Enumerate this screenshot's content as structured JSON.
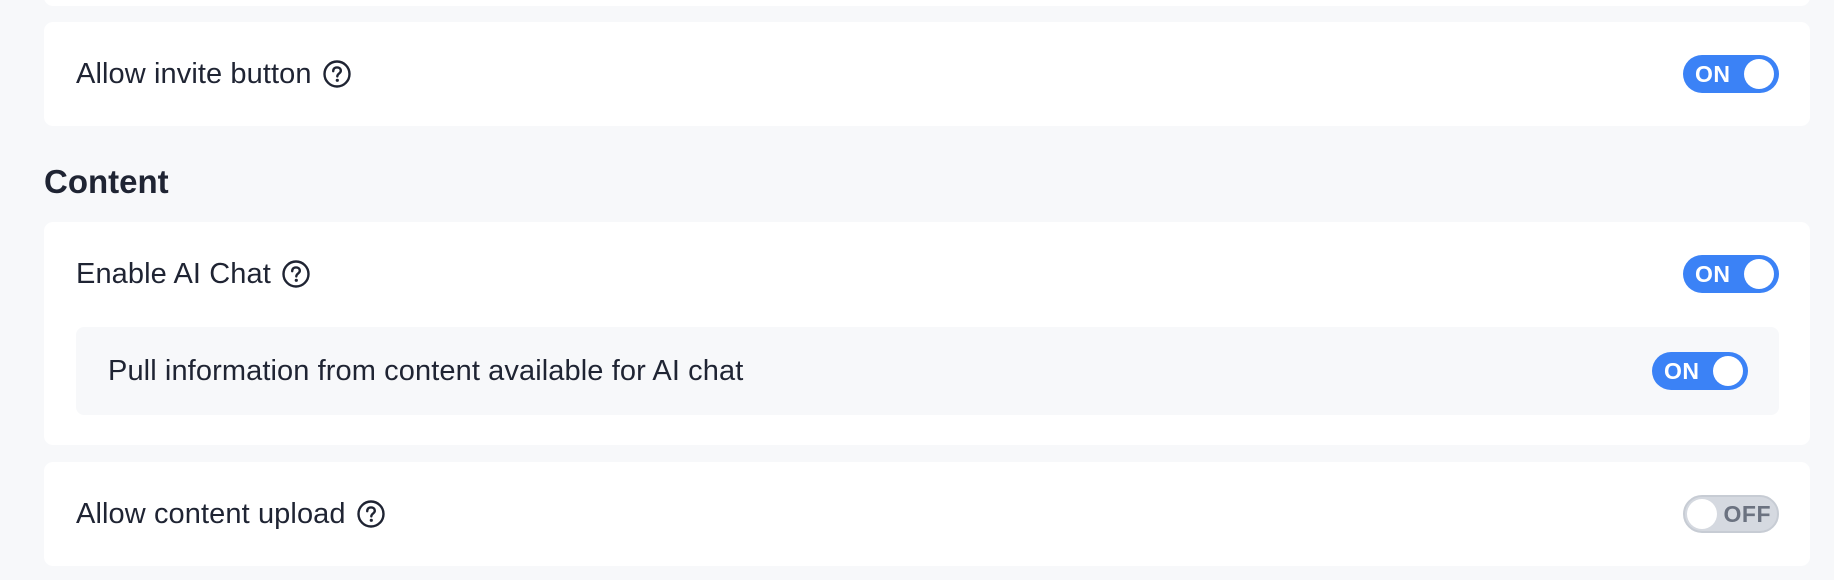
{
  "colors": {
    "accent": "#3b82f6",
    "background": "#f7f8fa",
    "card": "#ffffff",
    "text": "#1f2433",
    "toggle_off": "#d5d9e0"
  },
  "invite": {
    "label": "Allow invite button",
    "help_icon": "question-circle-icon",
    "toggle": {
      "state": "on",
      "text": "ON"
    }
  },
  "content_section": {
    "title": "Content",
    "ai_chat": {
      "label": "Enable AI Chat",
      "help_icon": "question-circle-icon",
      "toggle": {
        "state": "on",
        "text": "ON"
      },
      "sub_setting": {
        "label": "Pull information from content available for AI chat",
        "toggle": {
          "state": "on",
          "text": "ON"
        }
      }
    },
    "upload": {
      "label": "Allow content upload",
      "help_icon": "question-circle-icon",
      "toggle": {
        "state": "off",
        "text": "OFF"
      }
    }
  }
}
